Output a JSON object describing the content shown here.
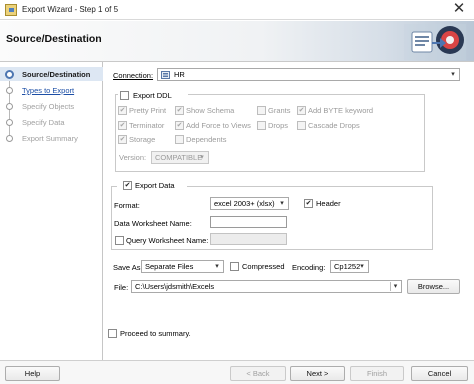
{
  "window": {
    "title": "Export Wizard - Step 1 of 5",
    "close_glyph": "✕"
  },
  "header": {
    "title": "Source/Destination"
  },
  "nav": {
    "items": [
      {
        "label": "Source/Destination",
        "state": "current"
      },
      {
        "label": "Types to Export",
        "state": "link"
      },
      {
        "label": "Specify Objects",
        "state": "disabled"
      },
      {
        "label": "Specify Data",
        "state": "disabled"
      },
      {
        "label": "Export Summary",
        "state": "disabled"
      }
    ]
  },
  "connection": {
    "label": "Connection:",
    "value": "HR"
  },
  "export_ddl": {
    "label": "Export DDL",
    "checked": false,
    "options": [
      {
        "label": "Pretty Print",
        "checked": true
      },
      {
        "label": "Show Schema",
        "checked": true
      },
      {
        "label": "Grants",
        "checked": false
      },
      {
        "label": "Add BYTE keyword",
        "checked": true
      },
      {
        "label": "Terminator",
        "checked": true
      },
      {
        "label": "Add Force to Views",
        "checked": true
      },
      {
        "label": "Drops",
        "checked": false
      },
      {
        "label": "Cascade Drops",
        "checked": false
      },
      {
        "label": "Storage",
        "checked": true
      },
      {
        "label": "Dependents",
        "checked": false
      }
    ],
    "version_label": "Version:",
    "version_value": "COMPATIBLE"
  },
  "export_data": {
    "label": "Export Data",
    "checked": true,
    "format_label": "Format:",
    "format_value": "excel 2003+ (xlsx)",
    "header_label": "Header",
    "header_checked": true,
    "data_ws_label": "Data Worksheet Name:",
    "data_ws_value": "",
    "query_ws_label": "Query Worksheet Name:",
    "query_ws_checked": false,
    "query_ws_value": ""
  },
  "save": {
    "save_as_label": "Save As",
    "save_as_value": "Separate Files",
    "compressed_label": "Compressed",
    "compressed_checked": false,
    "encoding_label": "Encoding:",
    "encoding_value": "Cp1252",
    "file_label": "File:",
    "file_value": "C:\\Users\\jdsmith\\Excels",
    "browse_label": "Browse..."
  },
  "proceed": {
    "label": "Proceed to summary.",
    "checked": false
  },
  "footer": {
    "help": "Help",
    "back": "< Back",
    "next": "Next >",
    "finish": "Finish",
    "cancel": "Cancel"
  },
  "glyphs": {
    "check": "✔",
    "dropdown": "▾"
  }
}
